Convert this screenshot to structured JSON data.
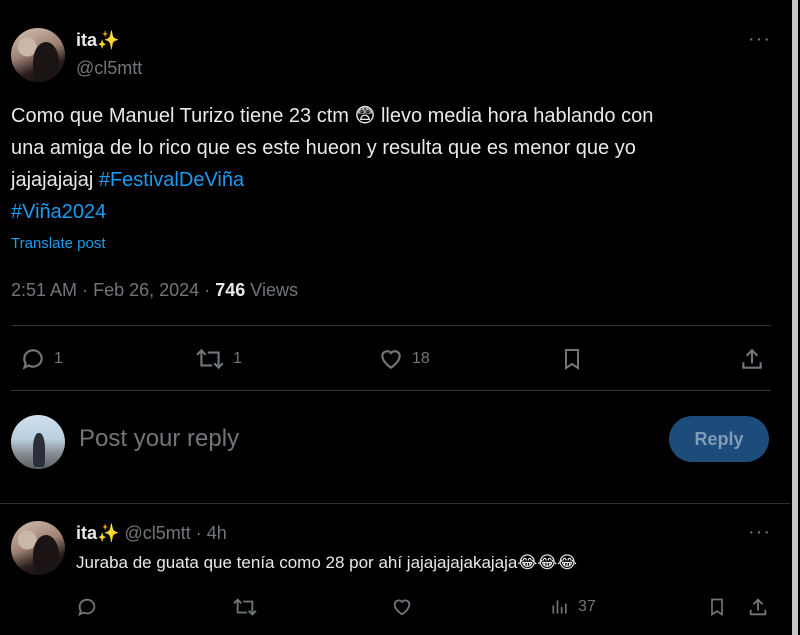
{
  "post": {
    "author_name": "ita",
    "author_emoji": "✨",
    "author_handle": "@cl5mtt",
    "more_icon": "more-dots-icon",
    "text_line1_a": "Como que Manuel Turizo tiene 23 ctm",
    "text_line1_emoji": "😨",
    "text_line1_b": "llevo media hora hablando con",
    "text_line2": "una amiga de lo rico que es este hueon y resulta que es menor que yo",
    "text_line3": "jajajajajaj",
    "hashtag1": "#FestivalDeViña",
    "hashtag2": "#Viña2024",
    "translate_label": "Translate post",
    "time": "2:51 AM",
    "sep": "·",
    "date": "Feb 26, 2024",
    "views_count": "746",
    "views_label": "Views"
  },
  "actions": {
    "replies": "1",
    "reposts": "1",
    "likes": "18"
  },
  "composer": {
    "placeholder": "Post your reply",
    "button_label": "Reply"
  },
  "reply": {
    "author_name": "ita",
    "author_emoji": "✨",
    "author_handle": "@cl5mtt",
    "sep": "·",
    "time_ago": "4h",
    "text": "Juraba de guata que tenía como 28 por ahí jajajajajakajaja",
    "text_emojis": "😂😂😂",
    "views": "37"
  },
  "colors": {
    "background": "#000000",
    "text": "#e7e9ea",
    "muted": "#71767b",
    "accent": "#1d9bf0",
    "divider": "#2f3336"
  }
}
